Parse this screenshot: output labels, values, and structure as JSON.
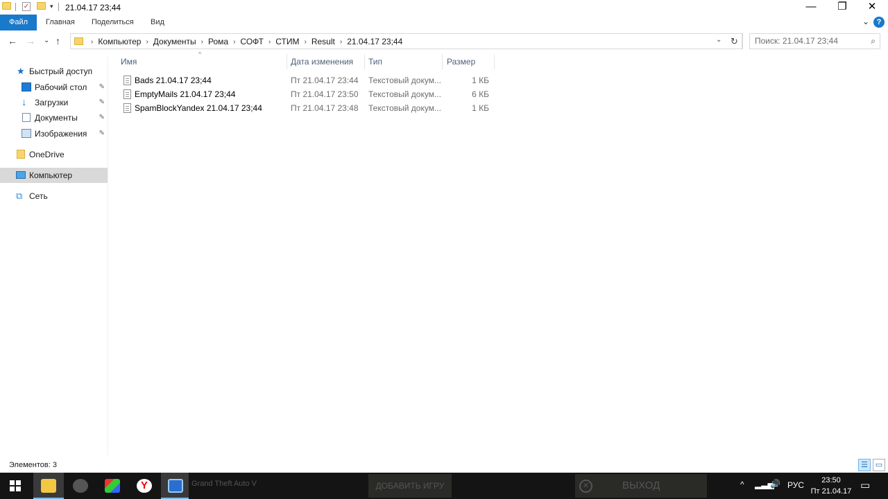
{
  "window": {
    "title": "21.04.17 23;44",
    "minimize": "—",
    "maximize": "❐",
    "close": "✕"
  },
  "quick_access_toolbar": {
    "dropdown": "▾"
  },
  "ribbon": {
    "tabs": [
      "Файл",
      "Главная",
      "Поделиться",
      "Вид"
    ],
    "expand": "⌄",
    "help": "?"
  },
  "navigation": {
    "back": "←",
    "forward": "→",
    "recent": "⌄",
    "up": "↑"
  },
  "address_bar": {
    "path": [
      "Компьютер",
      "Документы",
      "Рома",
      "СОФТ",
      "СТИМ",
      "Result",
      "21.04.17 23;44"
    ],
    "separator": "›",
    "dropdown": "⌄",
    "refresh": "↻"
  },
  "search": {
    "placeholder": "Поиск: 21.04.17 23;44",
    "icon": "⌕"
  },
  "nav_pane": {
    "quick_access": "Быстрый доступ",
    "items": [
      {
        "label": "Рабочий стол",
        "pinned": true
      },
      {
        "label": "Загрузки",
        "pinned": true
      },
      {
        "label": "Документы",
        "pinned": true
      },
      {
        "label": "Изображения",
        "pinned": true
      }
    ],
    "onedrive": "OneDrive",
    "computer": "Компьютер",
    "network": "Сеть",
    "pin_glyph": "📌"
  },
  "columns": {
    "name": "Имя",
    "date": "Дата изменения",
    "type": "Тип",
    "size": "Размер"
  },
  "files": [
    {
      "name": "Bads 21.04.17 23;44",
      "date": "Пт 21.04.17 23:44",
      "type": "Текстовый докум...",
      "size": "1 КБ"
    },
    {
      "name": "EmptyMails 21.04.17 23;44",
      "date": "Пт 21.04.17 23:50",
      "type": "Текстовый докум...",
      "size": "6 КБ"
    },
    {
      "name": "SpamBlockYandex 21.04.17 23;44",
      "date": "Пт 21.04.17 23:48",
      "type": "Текстовый докум...",
      "size": "1 КБ"
    }
  ],
  "status": {
    "count": "Элементов: 3"
  },
  "taskbar": {
    "ghost_text": "Grand Theft Auto V",
    "add_game": "ДОБАВИТЬ ИГРУ",
    "exit": "ВЫХОД",
    "language": "РУС",
    "time": "23:50",
    "date": "Пт 21.04.17",
    "tray_chevron": "^",
    "volume": "🔊"
  },
  "colors": {
    "file_tab": "#1979ca",
    "selection": "#d9d9d9",
    "header_text": "#4c607a",
    "taskbar": "#141414"
  }
}
